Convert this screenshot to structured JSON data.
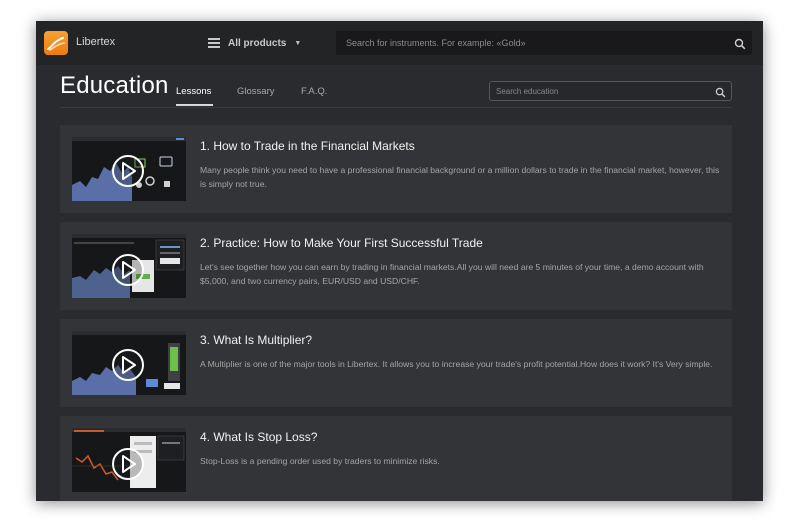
{
  "app": {
    "brand": "Libertex",
    "products_menu": "All products",
    "search_placeholder": "Search for instruments. For example: «Gold»"
  },
  "page": {
    "title": "Education",
    "tabs": [
      {
        "label": "Lessons",
        "active": true
      },
      {
        "label": "Glossary",
        "active": false
      },
      {
        "label": "F.A.Q.",
        "active": false
      }
    ],
    "search_placeholder": "Search education"
  },
  "lessons": [
    {
      "title": "1. How to Trade in the Financial Markets",
      "description": "Many people think you need to have a professional financial background or a million dollars to trade in the financial market, however, this is simply not true."
    },
    {
      "title": "2. Practice: How to Make Your First Successful Trade",
      "description": "Let's see together how you can earn by trading in financial markets.All you will need are 5 minutes of your time, a demo account with $5,000, and two currency pairs, EUR/USD and USD/CHF."
    },
    {
      "title": "3. What Is Multiplier?",
      "description": "A Multiplier is one of the major tools in Libertex. It allows you to increase your trade's profit potential.How does it work? It's Very simple."
    },
    {
      "title": "4. What Is Stop Loss?",
      "description": "Stop-Loss is a pending order used by traders to minimize risks."
    }
  ],
  "colors": {
    "accent_orange": "#ee8a1e",
    "background": "#2a2b2e",
    "card": "#333437",
    "chart_blue": "#5a6fa8"
  },
  "icons": {
    "menu": "hamburger-icon",
    "search": "search-icon",
    "play": "play-icon",
    "logo": "libertex-logo"
  }
}
